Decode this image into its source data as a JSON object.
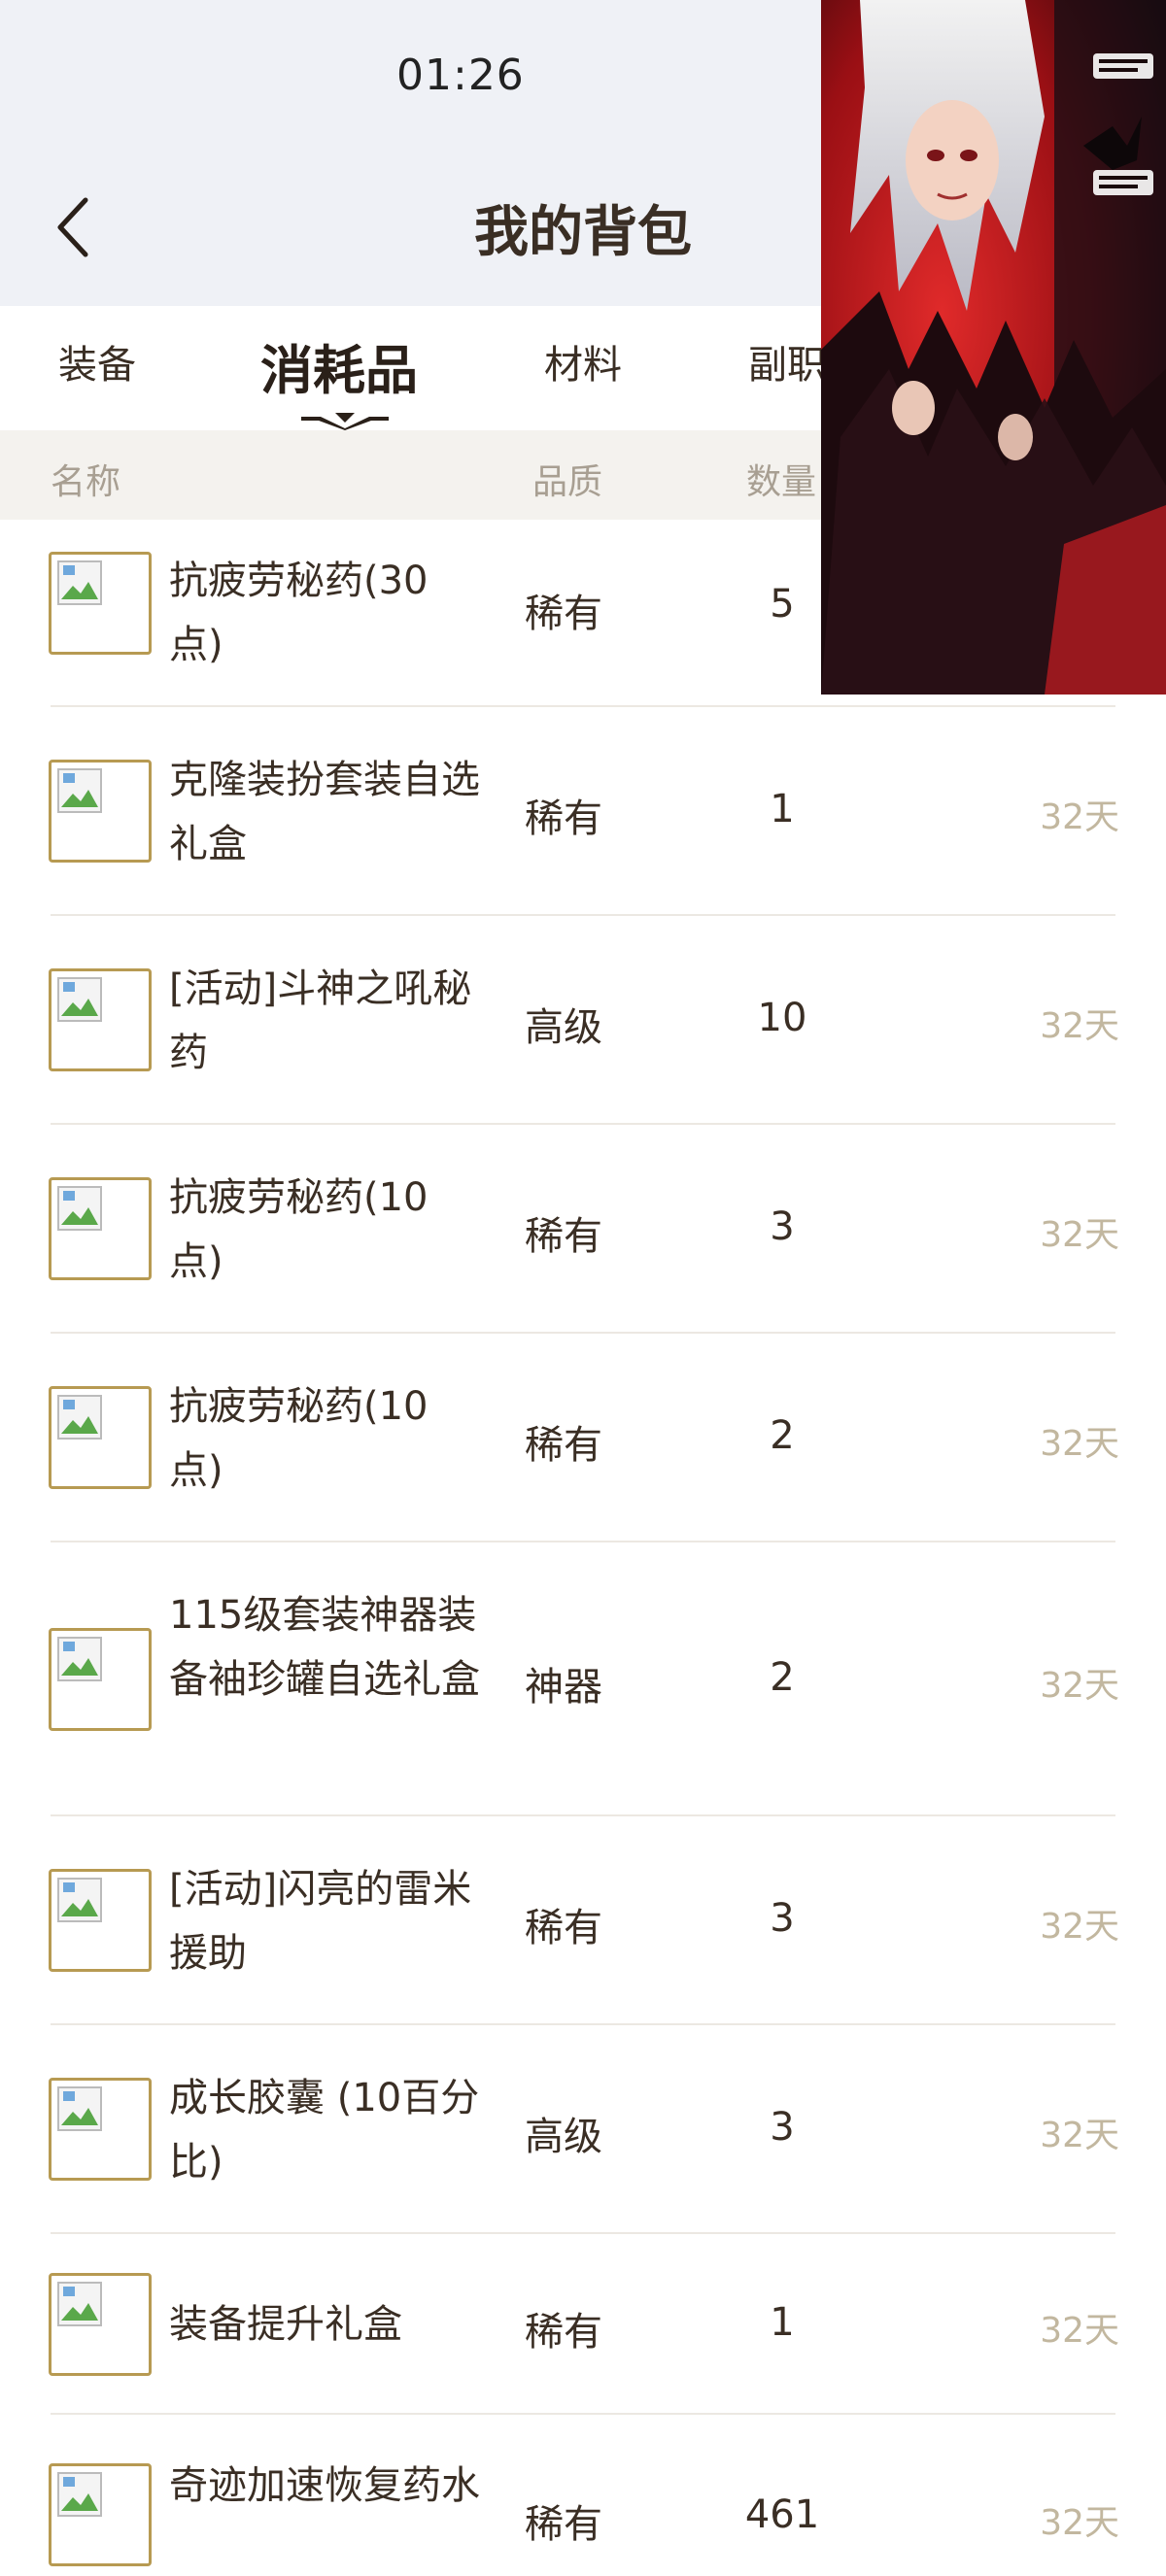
{
  "status_bar": {
    "time": "01:26"
  },
  "nav": {
    "title": "我的背包"
  },
  "tabs": [
    {
      "label": "装备",
      "active": false
    },
    {
      "label": "消耗品",
      "active": true
    },
    {
      "label": "材料",
      "active": false
    },
    {
      "label": "副职",
      "active": false
    }
  ],
  "columns": {
    "name": "名称",
    "quality": "品质",
    "count": "数量"
  },
  "items": [
    {
      "name": "抗疲劳秘药(30点)",
      "quality": "稀有",
      "count": "5",
      "expire": ""
    },
    {
      "name": "克隆装扮套装自选礼盒",
      "quality": "稀有",
      "count": "1",
      "expire": "32天"
    },
    {
      "name": "[活动]斗神之吼秘药",
      "quality": "高级",
      "count": "10",
      "expire": "32天"
    },
    {
      "name": "抗疲劳秘药(10点)",
      "quality": "稀有",
      "count": "3",
      "expire": "32天"
    },
    {
      "name": "抗疲劳秘药(10点)",
      "quality": "稀有",
      "count": "2",
      "expire": "32天"
    },
    {
      "name": "115级套装神器装备袖珍罐自选礼盒",
      "quality": "神器",
      "count": "2",
      "expire": "32天"
    },
    {
      "name": "[活动]闪亮的雷米援助",
      "quality": "稀有",
      "count": "3",
      "expire": "32天"
    },
    {
      "name": "成长胶囊 (10百分比)",
      "quality": "高级",
      "count": "3",
      "expire": "32天"
    },
    {
      "name": "装备提升礼盒",
      "quality": "稀有",
      "count": "1",
      "expire": "32天"
    },
    {
      "name": "奇迹加速恢复药水",
      "quality": "稀有",
      "count": "461",
      "expire": "32天"
    }
  ],
  "icons": {
    "back": "chevron-left-icon",
    "thumbnail": "broken-image-icon"
  },
  "colors": {
    "accent": "#b79a52",
    "text": "#3a2e24",
    "muted": "#a89f92",
    "expire": "#c2b79f"
  }
}
